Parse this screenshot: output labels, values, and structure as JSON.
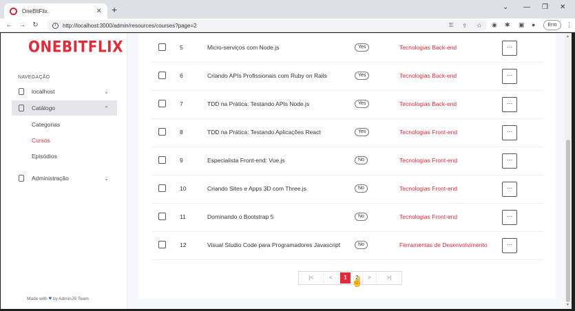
{
  "browser": {
    "tab_title": "OneBitFlix",
    "url": "http://localhost:3000/admin/resources/courses?page=2",
    "error_label": "Erro"
  },
  "sidebar": {
    "logo": "ONEBITFLIX",
    "nav_heading": "NAVEGAÇÃO",
    "items": [
      {
        "label": "localhost"
      },
      {
        "label": "Catálogo"
      },
      {
        "label": "Administração"
      }
    ],
    "subitems": [
      {
        "label": "Categorias"
      },
      {
        "label": "Cursos"
      },
      {
        "label": "Episódios"
      }
    ],
    "footer": {
      "made_with": "Made with",
      "by": "by AdminJS Team"
    }
  },
  "table": {
    "rows": [
      {
        "id": "5",
        "name": "Micro-serviços com Node.js",
        "featured": "Yes",
        "category": "Tecnologias Back-end"
      },
      {
        "id": "6",
        "name": "Criando APIs Profissionais com Ruby on Rails",
        "featured": "Yes",
        "category": "Tecnologias Back-end"
      },
      {
        "id": "7",
        "name": "TDD na Prática: Testando APIs Node.js",
        "featured": "Yes",
        "category": "Tecnologias Back-end"
      },
      {
        "id": "8",
        "name": "TDD na Prática: Testando Aplicações React",
        "featured": "Yes",
        "category": "Tecnologias Front-end"
      },
      {
        "id": "9",
        "name": "Especialista Front-end: Vue.js",
        "featured": "No",
        "category": "Tecnologias Front-end"
      },
      {
        "id": "10",
        "name": "Criando Sites e Apps 3D com Three.js",
        "featured": "No",
        "category": "Tecnologias Front-end"
      },
      {
        "id": "11",
        "name": "Dominando o Bootstrap 5",
        "featured": "No",
        "category": "Tecnologias Front-end"
      },
      {
        "id": "12",
        "name": "Visual Studio Code para Programadores Javascript",
        "featured": "No",
        "category": "Ferramentas de Desenvolvimento"
      }
    ],
    "more_label": "···"
  },
  "pagination": {
    "first": "|<",
    "prev": "<",
    "pages": [
      "1",
      "2"
    ],
    "current": "1",
    "next": ">",
    "last": ">|"
  }
}
